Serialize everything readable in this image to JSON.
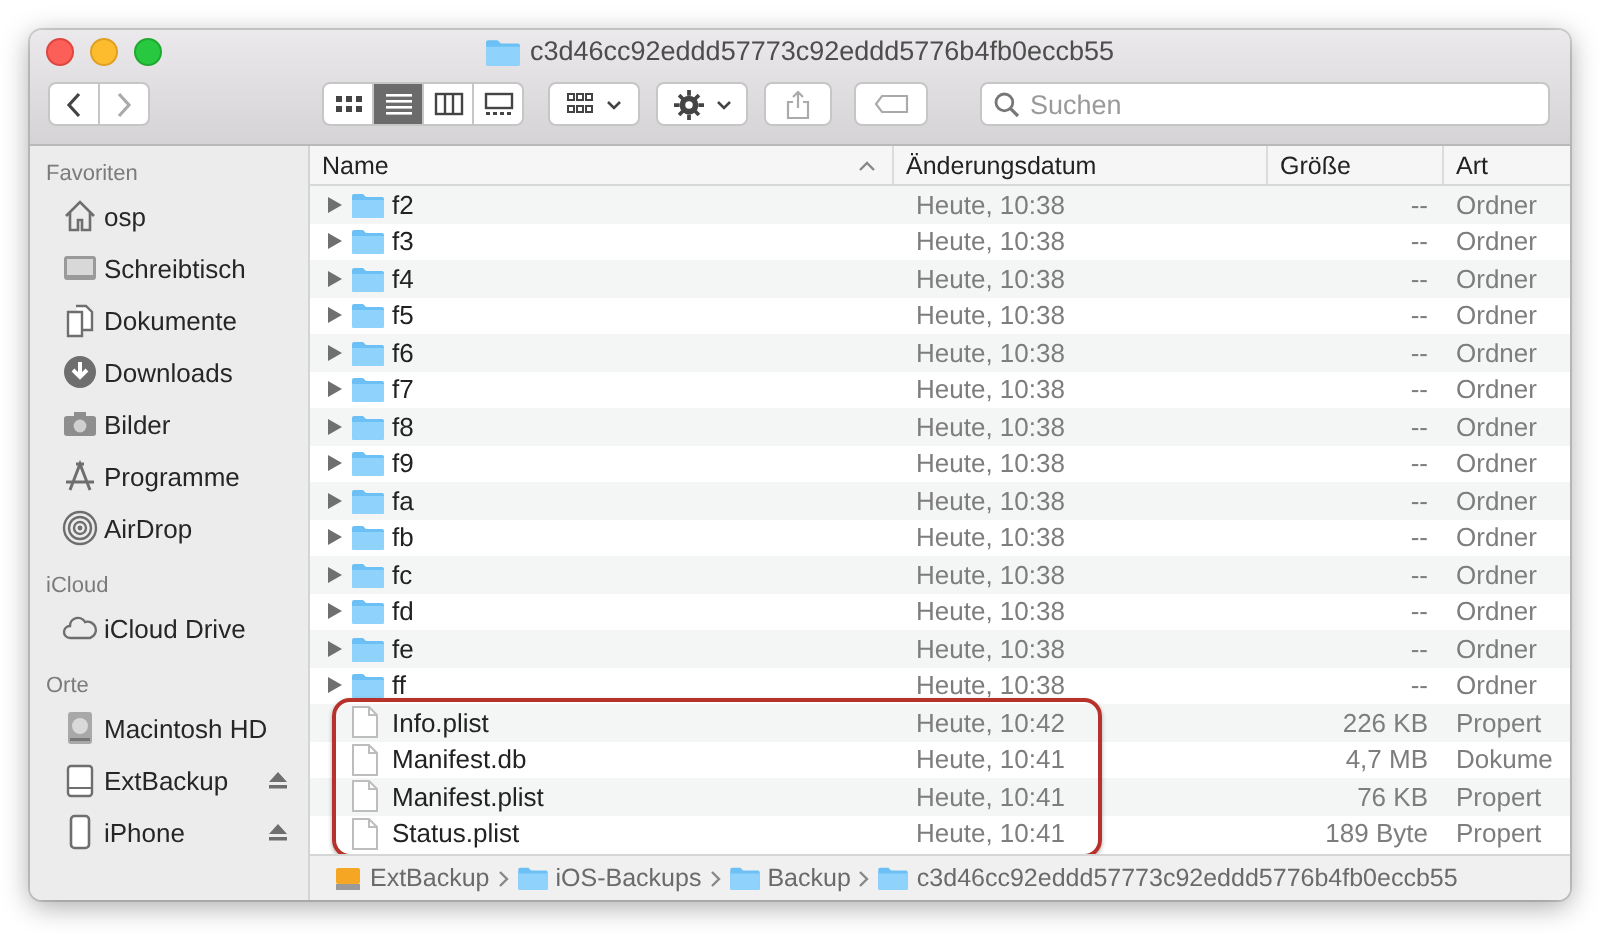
{
  "window": {
    "title": "c3d46cc92eddd57773c92eddd5776b4fb0eccb55"
  },
  "toolbar": {
    "view_modes": [
      {
        "kind": "icons",
        "selected": false
      },
      {
        "kind": "list",
        "selected": true
      },
      {
        "kind": "columns",
        "selected": false
      },
      {
        "kind": "gallery",
        "selected": false
      }
    ],
    "search": {
      "placeholder": "Suchen"
    }
  },
  "sidebar": {
    "sections": [
      {
        "title": "Favoriten",
        "items": [
          {
            "kind": "home",
            "label": "osp",
            "eject": false
          },
          {
            "kind": "desktop",
            "label": "Schreibtisch",
            "eject": false
          },
          {
            "kind": "documents",
            "label": "Dokumente",
            "eject": false
          },
          {
            "kind": "downloads",
            "label": "Downloads",
            "eject": false
          },
          {
            "kind": "pictures",
            "label": "Bilder",
            "eject": false
          },
          {
            "kind": "apps",
            "label": "Programme",
            "eject": false
          },
          {
            "kind": "airdrop",
            "label": "AirDrop",
            "eject": false
          }
        ]
      },
      {
        "title": "iCloud",
        "items": [
          {
            "kind": "cloud",
            "label": "iCloud Drive",
            "eject": false
          }
        ]
      },
      {
        "title": "Orte",
        "items": [
          {
            "kind": "disk",
            "label": "Macintosh HD",
            "eject": false
          },
          {
            "kind": "external",
            "label": "ExtBackup",
            "eject": true
          },
          {
            "kind": "phone",
            "label": "iPhone",
            "eject": true
          }
        ]
      }
    ]
  },
  "table": {
    "columns": [
      {
        "label": "Name",
        "sorted": true
      },
      {
        "label": "Änderungsdatum",
        "sorted": false
      },
      {
        "label": "Größe",
        "sorted": false
      },
      {
        "label": "Art",
        "sorted": false
      }
    ],
    "rows": [
      {
        "kind": "folder",
        "name": "f2",
        "date": "Heute, 10:38",
        "size": "--",
        "type": "Ordner",
        "highlighted": false
      },
      {
        "kind": "folder",
        "name": "f3",
        "date": "Heute, 10:38",
        "size": "--",
        "type": "Ordner",
        "highlighted": false
      },
      {
        "kind": "folder",
        "name": "f4",
        "date": "Heute, 10:38",
        "size": "--",
        "type": "Ordner",
        "highlighted": false
      },
      {
        "kind": "folder",
        "name": "f5",
        "date": "Heute, 10:38",
        "size": "--",
        "type": "Ordner",
        "highlighted": false
      },
      {
        "kind": "folder",
        "name": "f6",
        "date": "Heute, 10:38",
        "size": "--",
        "type": "Ordner",
        "highlighted": false
      },
      {
        "kind": "folder",
        "name": "f7",
        "date": "Heute, 10:38",
        "size": "--",
        "type": "Ordner",
        "highlighted": false
      },
      {
        "kind": "folder",
        "name": "f8",
        "date": "Heute, 10:38",
        "size": "--",
        "type": "Ordner",
        "highlighted": false
      },
      {
        "kind": "folder",
        "name": "f9",
        "date": "Heute, 10:38",
        "size": "--",
        "type": "Ordner",
        "highlighted": false
      },
      {
        "kind": "folder",
        "name": "fa",
        "date": "Heute, 10:38",
        "size": "--",
        "type": "Ordner",
        "highlighted": false
      },
      {
        "kind": "folder",
        "name": "fb",
        "date": "Heute, 10:38",
        "size": "--",
        "type": "Ordner",
        "highlighted": false
      },
      {
        "kind": "folder",
        "name": "fc",
        "date": "Heute, 10:38",
        "size": "--",
        "type": "Ordner",
        "highlighted": false
      },
      {
        "kind": "folder",
        "name": "fd",
        "date": "Heute, 10:38",
        "size": "--",
        "type": "Ordner",
        "highlighted": false
      },
      {
        "kind": "folder",
        "name": "fe",
        "date": "Heute, 10:38",
        "size": "--",
        "type": "Ordner",
        "highlighted": false
      },
      {
        "kind": "folder",
        "name": "ff",
        "date": "Heute, 10:38",
        "size": "--",
        "type": "Ordner",
        "highlighted": false
      },
      {
        "kind": "file",
        "name": "Info.plist",
        "date": "Heute, 10:42",
        "size": "226 KB",
        "type": "Propert",
        "highlighted": true
      },
      {
        "kind": "file",
        "name": "Manifest.db",
        "date": "Heute, 10:41",
        "size": "4,7 MB",
        "type": "Dokume",
        "highlighted": true
      },
      {
        "kind": "file",
        "name": "Manifest.plist",
        "date": "Heute, 10:41",
        "size": "76 KB",
        "type": "Propert",
        "highlighted": true
      },
      {
        "kind": "file",
        "name": "Status.plist",
        "date": "Heute, 10:41",
        "size": "189 Byte",
        "type": "Propert",
        "highlighted": true
      }
    ]
  },
  "path_bar": [
    {
      "kind": "drive",
      "label": "ExtBackup"
    },
    {
      "kind": "folder",
      "label": "iOS-Backups"
    },
    {
      "kind": "folder",
      "label": "Backup"
    },
    {
      "kind": "folder",
      "label": "c3d46cc92eddd57773c92eddd5776b4fb0eccb55"
    }
  ]
}
